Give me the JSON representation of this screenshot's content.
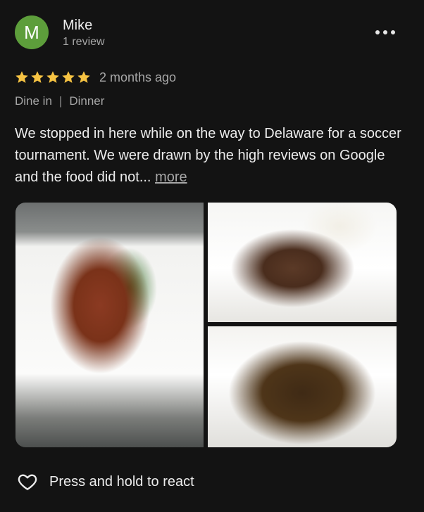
{
  "reviewer": {
    "initial": "M",
    "name": "Mike",
    "review_count": "1 review",
    "avatar_color": "#5d9e3b"
  },
  "rating": {
    "stars": 5,
    "max": 5,
    "time": "2 months ago",
    "star_color": "#f6c343"
  },
  "meta": {
    "service": "Dine in",
    "separator": "|",
    "meal": "Dinner"
  },
  "review": {
    "text": "We stopped in here while on the way to Delaware for a soccer tournament.  We were drawn by the high reviews on Google and the food did not...",
    "more_label": "more"
  },
  "actions": {
    "react_label": "Press and hold to react"
  }
}
